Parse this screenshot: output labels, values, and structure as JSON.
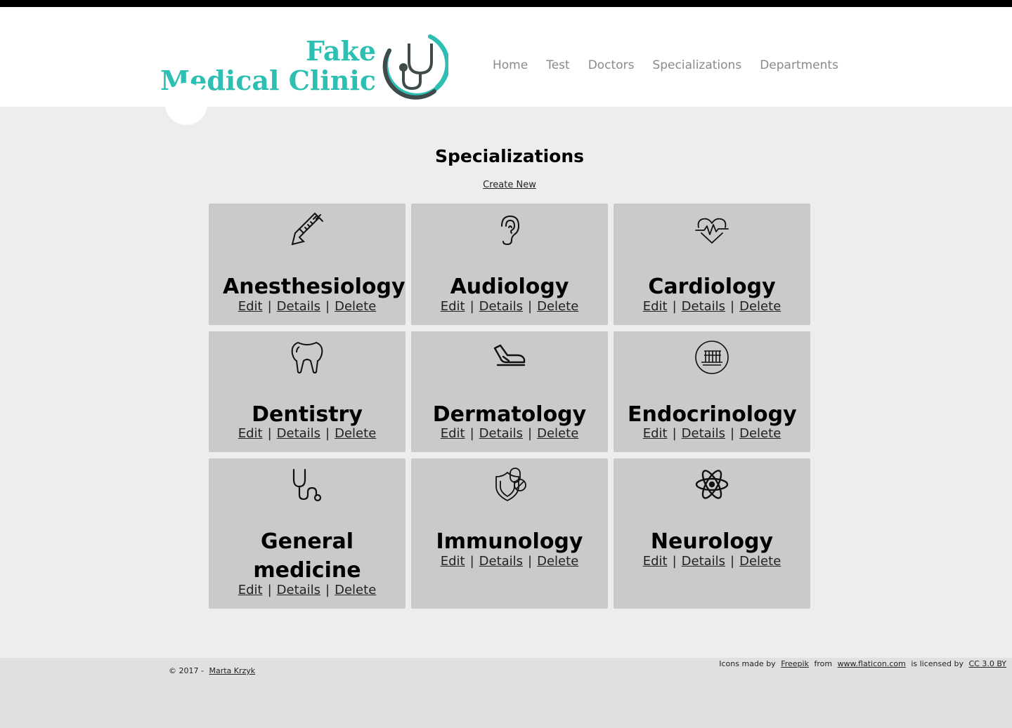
{
  "brand": {
    "line1": "Fake",
    "line2": "Medical Clinic",
    "accent": "#2cbfb2",
    "dark": "#3f4a4b"
  },
  "nav": [
    "Home",
    "Test",
    "Doctors",
    "Specializations",
    "Departments"
  ],
  "page": {
    "title": "Specializations",
    "create_new": "Create New"
  },
  "actions": {
    "edit": "Edit",
    "details": "Details",
    "delete": "Delete",
    "separator": "|"
  },
  "cards": [
    {
      "name": "Anesthesiology",
      "icon": "syringe-icon"
    },
    {
      "name": "Audiology",
      "icon": "ear-icon"
    },
    {
      "name": "Cardiology",
      "icon": "heartbeat-icon"
    },
    {
      "name": "Dentistry",
      "icon": "tooth-icon"
    },
    {
      "name": "Dermatology",
      "icon": "hand-icon"
    },
    {
      "name": "Endocrinology",
      "icon": "test-tubes-icon"
    },
    {
      "name": "General medicine",
      "icon": "stethoscope-icon"
    },
    {
      "name": "Immunology",
      "icon": "shield-pill-icon"
    },
    {
      "name": "Neurology",
      "icon": "atom-icon"
    }
  ],
  "footer": {
    "copyright": "© 2017 -",
    "author": "Marta Krzyk",
    "icons_made_by": "Icons made by",
    "freepik": "Freepik",
    "from": "from",
    "flaticon": "www.flaticon.com",
    "licensed_by": "is licensed by",
    "license": "CC 3.0 BY"
  }
}
